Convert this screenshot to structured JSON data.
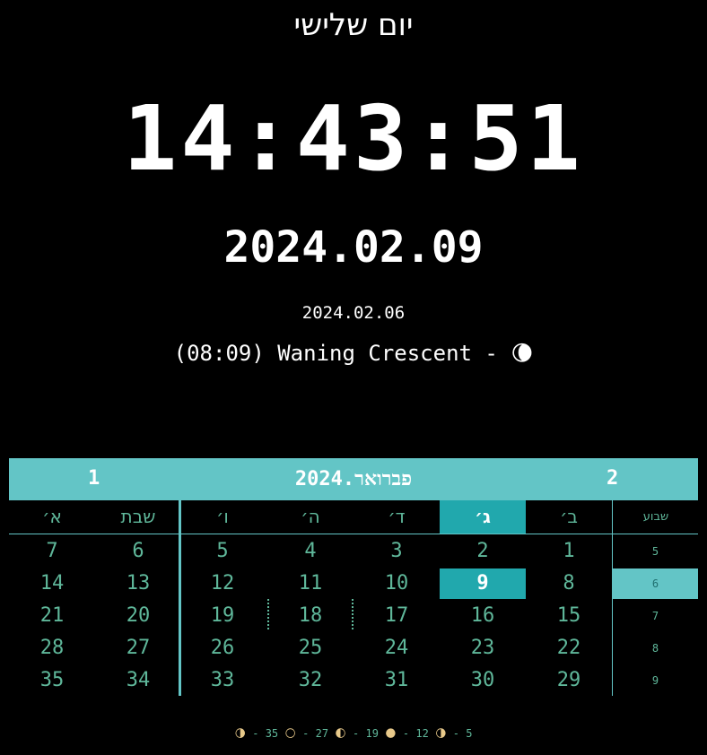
{
  "header": {
    "day_name": "יום שלישי",
    "time": "14:43:51",
    "date_main": "2024.02.09",
    "date_secondary": "2024.02.06",
    "moon_text": "(08:09) Waning Crescent - ",
    "moon_icon": "🌘"
  },
  "calendar": {
    "left_label": "1",
    "month_label": "פברואר.2024",
    "right_label": "2",
    "days_of_week": [
      "א׳",
      "שבת",
      "ו׳",
      "ה׳",
      "ד׳",
      "ג׳",
      "ב׳"
    ],
    "week_header": "שבוע",
    "today_col": 5,
    "rows": [
      {
        "week": "5",
        "days": [
          "7",
          "6",
          "5",
          "4",
          "3",
          "2",
          "1"
        ]
      },
      {
        "week": "6",
        "days": [
          "14",
          "13",
          "12",
          "11",
          "10",
          "9",
          "8"
        ]
      },
      {
        "week": "7",
        "days": [
          "21",
          "20",
          "19",
          "18",
          "17",
          "16",
          "15"
        ]
      },
      {
        "week": "8",
        "days": [
          "28",
          "27",
          "26",
          "25",
          "24",
          "23",
          "22"
        ]
      },
      {
        "week": "9",
        "days": [
          "35",
          "34",
          "33",
          "32",
          "31",
          "30",
          "29"
        ]
      }
    ],
    "current_week": "6",
    "colors": {
      "accent": "#63c5c6",
      "today": "#21a8ad",
      "text": "#5fb79a"
    }
  },
  "footer": {
    "phases": [
      {
        "icon": "🌗",
        "day": "35"
      },
      {
        "icon": "🌕",
        "day": "27"
      },
      {
        "icon": "🌓",
        "day": "19"
      },
      {
        "icon": "🌑",
        "day": "12"
      },
      {
        "icon": "🌗",
        "day": "5"
      }
    ]
  }
}
